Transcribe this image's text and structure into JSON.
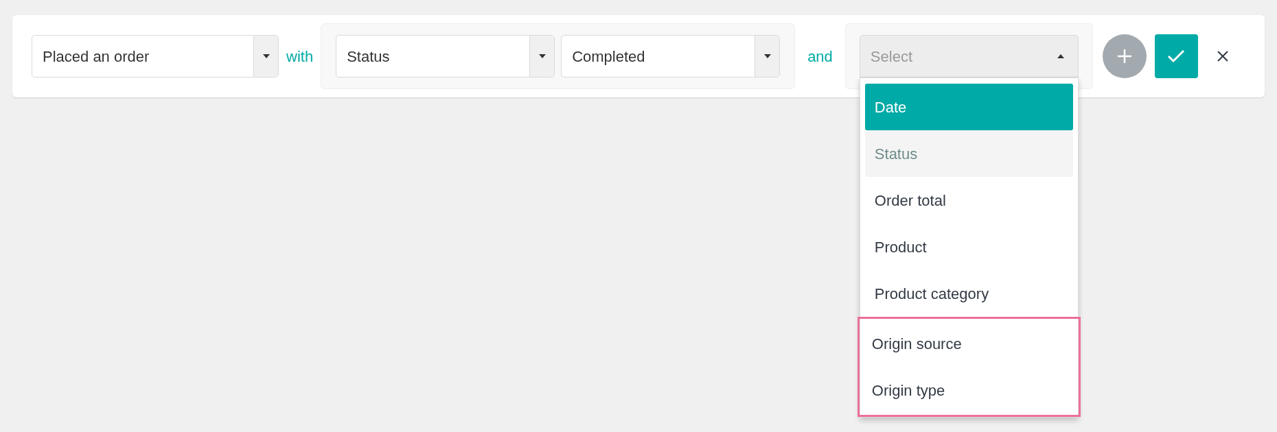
{
  "event_select": {
    "value": "Placed an order"
  },
  "with_label": "with",
  "condition": {
    "field": {
      "value": "Status"
    },
    "value": {
      "value": "Completed"
    }
  },
  "and_label": "and",
  "next_field": {
    "placeholder": "Select",
    "expanded": true,
    "options": [
      {
        "label": "Date",
        "selected": true,
        "disabled": false,
        "highlighted": false
      },
      {
        "label": "Status",
        "selected": false,
        "disabled": true,
        "highlighted": false
      },
      {
        "label": "Order total",
        "selected": false,
        "disabled": false,
        "highlighted": false
      },
      {
        "label": "Product",
        "selected": false,
        "disabled": false,
        "highlighted": false
      },
      {
        "label": "Product category",
        "selected": false,
        "disabled": false,
        "highlighted": false
      },
      {
        "label": "Origin source",
        "selected": false,
        "disabled": false,
        "highlighted": true
      },
      {
        "label": "Origin type",
        "selected": false,
        "disabled": false,
        "highlighted": true
      }
    ]
  }
}
